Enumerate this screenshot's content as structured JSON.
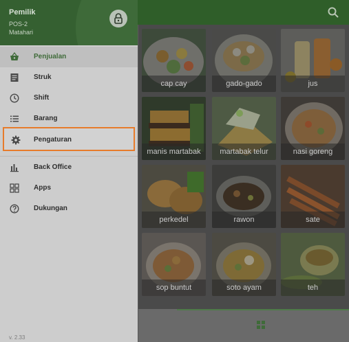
{
  "drawer": {
    "owner": "Pemilik",
    "pos": "POS-2",
    "store": "Matahari",
    "menu": [
      {
        "label": "Penjualan",
        "icon": "basket-icon",
        "active": true
      },
      {
        "label": "Struk",
        "icon": "receipt-icon"
      },
      {
        "label": "Shift",
        "icon": "clock-icon"
      },
      {
        "label": "Barang",
        "icon": "list-icon"
      },
      {
        "label": "Pengaturan",
        "icon": "gear-icon",
        "highlighted": true
      },
      {
        "label": "Back Office",
        "icon": "bar-chart-icon"
      },
      {
        "label": "Apps",
        "icon": "apps-icon"
      },
      {
        "label": "Dukungan",
        "icon": "help-icon"
      }
    ],
    "version": "v. 2.33"
  },
  "products": [
    {
      "name": "cap cay"
    },
    {
      "name": "gado-gado"
    },
    {
      "name": "jus"
    },
    {
      "name": "manis martabak"
    },
    {
      "name": "martabak telur"
    },
    {
      "name": "nasi goreng"
    },
    {
      "name": "perkedel"
    },
    {
      "name": "rawon"
    },
    {
      "name": "sate"
    },
    {
      "name": "sop buntut"
    },
    {
      "name": "soto ayam"
    },
    {
      "name": "teh"
    }
  ],
  "colors": {
    "brand_green": "#3f6b39",
    "highlight_orange": "#e77b2a"
  }
}
